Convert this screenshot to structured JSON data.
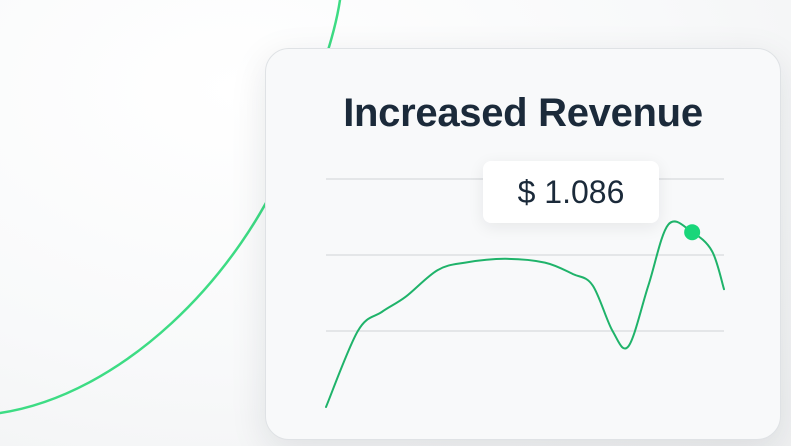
{
  "card": {
    "title": "Increased Revenue"
  },
  "tooltip": {
    "label": "$ 1.086"
  },
  "colors": {
    "line": "#1fb36a",
    "marker": "#19d67a",
    "arc": "#3ddc84",
    "grid": "#e4e6e8",
    "title": "#1b2a3a"
  },
  "chart_data": {
    "type": "line",
    "title": "Increased Revenue",
    "xlabel": "",
    "ylabel": "",
    "grid": true,
    "legend": "none",
    "xlim": [
      0,
      100
    ],
    "ylim": [
      0,
      3
    ],
    "gridlines": [
      1,
      2,
      3
    ],
    "series": [
      {
        "x": [
          0,
          8,
          14,
          20,
          28,
          35,
          45,
          55,
          62,
          67,
          72,
          76,
          81,
          86,
          92,
          97,
          100
        ],
        "y": [
          0.0,
          1.0,
          1.25,
          1.45,
          1.8,
          1.9,
          1.95,
          1.9,
          1.75,
          1.6,
          1.0,
          0.8,
          1.6,
          2.4,
          2.3,
          2.05,
          1.55
        ]
      }
    ],
    "highlight": {
      "x": 92,
      "y": 2.3,
      "label": "$ 1.086"
    }
  }
}
